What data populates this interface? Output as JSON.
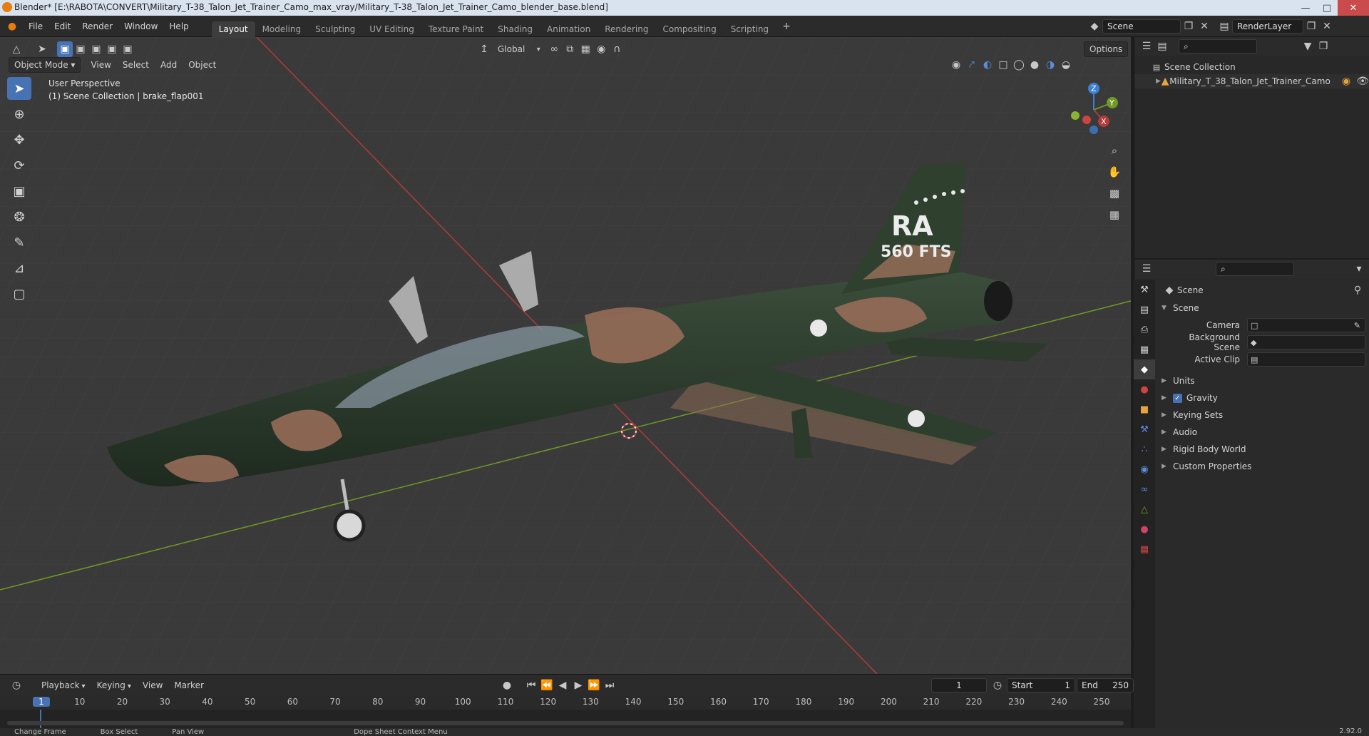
{
  "window": {
    "title": "Blender* [E:\\RABOTA\\CONVERT\\Military_T-38_Talon_Jet_Trainer_Camo_max_vray/Military_T-38_Talon_Jet_Trainer_Camo_blender_base.blend]"
  },
  "menu": [
    "File",
    "Edit",
    "Render",
    "Window",
    "Help"
  ],
  "workspaces": [
    "Layout",
    "Modeling",
    "Sculpting",
    "UV Editing",
    "Texture Paint",
    "Shading",
    "Animation",
    "Rendering",
    "Compositing",
    "Scripting"
  ],
  "active_workspace": "Layout",
  "scene_field": "Scene",
  "renderlayer_field": "RenderLayer",
  "viewport": {
    "transform_orientation": "Global",
    "options_label": "Options",
    "mode": "Object Mode",
    "header_menus": [
      "View",
      "Select",
      "Add",
      "Object"
    ],
    "info_line1": "User Perspective",
    "info_line2": "(1) Scene Collection | brake_flap001",
    "tail_code": "RA",
    "tail_unit": "560 FTS"
  },
  "gizmo": {
    "x": "X",
    "y": "Y",
    "z": "Z"
  },
  "outliner": {
    "root": "Scene Collection",
    "items": [
      "Military_T_38_Talon_Jet_Trainer_Camo"
    ]
  },
  "properties": {
    "context": "Scene",
    "panel": "Scene",
    "fields": [
      {
        "label": "Camera"
      },
      {
        "label": "Background Scene"
      },
      {
        "label": "Active Clip"
      }
    ],
    "sections": [
      "Units",
      "Gravity",
      "Keying Sets",
      "Audio",
      "Rigid Body World",
      "Custom Properties"
    ],
    "gravity_checked": true
  },
  "timeline": {
    "menus": [
      "Playback",
      "Keying",
      "View",
      "Marker"
    ],
    "current_frame": "1",
    "start_label": "Start",
    "start_value": "1",
    "end_label": "End",
    "end_value": "250",
    "ruler_ticks": [
      "1",
      "10",
      "20",
      "30",
      "40",
      "50",
      "60",
      "70",
      "80",
      "90",
      "100",
      "110",
      "120",
      "130",
      "140",
      "150",
      "160",
      "170",
      "180",
      "190",
      "200",
      "210",
      "220",
      "230",
      "240",
      "250"
    ]
  },
  "status": {
    "items": [
      "Change Frame",
      "Box Select",
      "Pan View",
      "Dope Sheet Context Menu"
    ],
    "version": "2.92.0"
  },
  "colors": {
    "accent": "#4772b3",
    "x_axis": "#b33a3a",
    "y_axis": "#6f9a24",
    "z_axis": "#3d7fd1",
    "camo_green": "#2c3b2c",
    "camo_tan": "#9b6f5a"
  }
}
